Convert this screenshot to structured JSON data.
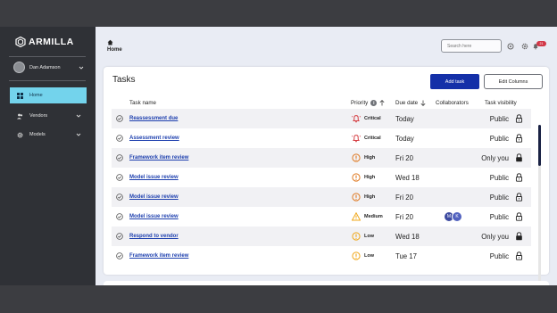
{
  "app": {
    "brand": "ARMILLA"
  },
  "colors": {
    "sidebar": "#2f3136",
    "active_nav": "#73d3ec",
    "primary_button": "#1430a8",
    "link": "#1d3fae",
    "critical": "#d64045",
    "warning": "#e07b24",
    "caution": "#f0a81c"
  },
  "sidebar": {
    "user_name": "Dan Adamson",
    "items": [
      {
        "label": "Home",
        "icon": "grid-icon",
        "active": true
      },
      {
        "label": "Vendors",
        "icon": "users-icon",
        "active": false
      },
      {
        "label": "Models",
        "icon": "gear-icon",
        "active": false
      }
    ]
  },
  "header": {
    "breadcrumb_icon": "home-icon",
    "title": "Home",
    "search_placeholder": "Search here",
    "notification_count": "21"
  },
  "tasks": {
    "title": "Tasks",
    "add_button": "Add task",
    "edit_columns_button": "Edit Columns",
    "columns": {
      "name": "Task name",
      "priority": "Priority",
      "due_date": "Due date",
      "collaborators": "Collaborators",
      "visibility": "Task visibility"
    },
    "rows": [
      {
        "name": "Reassessment due",
        "priority": "Critical",
        "priority_icon": "bell-alert-icon",
        "due": "Today",
        "collaborators": [],
        "visibility": "Public",
        "locked": false
      },
      {
        "name": "Assessment review",
        "priority": "Critical",
        "priority_icon": "bell-alert-icon",
        "due": "Today",
        "collaborators": [],
        "visibility": "Public",
        "locked": false
      },
      {
        "name": "Framework item review",
        "priority": "High",
        "priority_icon": "alert-circle-icon",
        "due": "Fri 20",
        "collaborators": [],
        "visibility": "Only you",
        "locked": true
      },
      {
        "name": "Model issue review",
        "priority": "High",
        "priority_icon": "alert-circle-icon",
        "due": "Wed 18",
        "collaborators": [],
        "visibility": "Public",
        "locked": false
      },
      {
        "name": "Model issue review",
        "priority": "High",
        "priority_icon": "alert-circle-icon",
        "due": "Fri 20",
        "collaborators": [],
        "visibility": "Public",
        "locked": false
      },
      {
        "name": "Model issue review",
        "priority": "Medium",
        "priority_icon": "alert-triangle-icon",
        "due": "Fri 20",
        "collaborators": [
          {
            "initial": "M",
            "color": "#3c4aa0"
          },
          {
            "initial": "K",
            "color": "#5262bf"
          }
        ],
        "visibility": "Public",
        "locked": false
      },
      {
        "name": "Respond to vendor",
        "priority": "Low",
        "priority_icon": "alert-circle-icon",
        "due": "Wed 18",
        "collaborators": [],
        "visibility": "Only you",
        "locked": true
      },
      {
        "name": "Framework item review",
        "priority": "Low",
        "priority_icon": "alert-circle-icon",
        "due": "Tue 17",
        "collaborators": [],
        "visibility": "Public",
        "locked": false
      }
    ]
  }
}
